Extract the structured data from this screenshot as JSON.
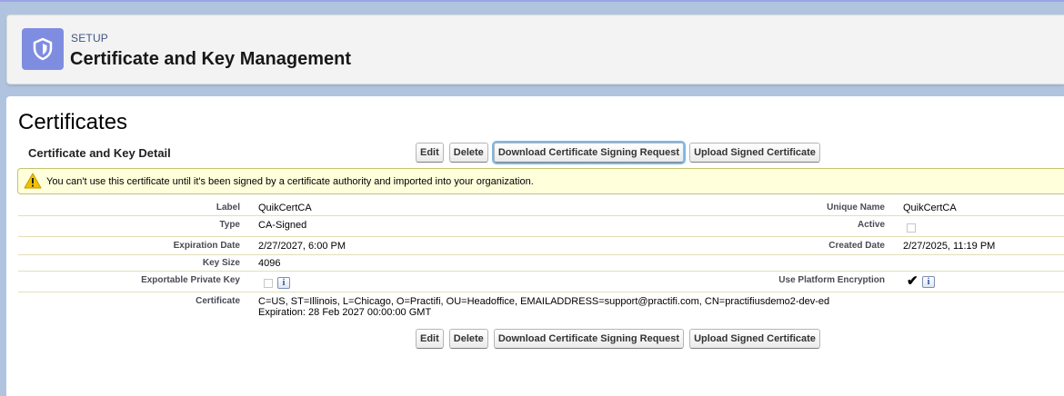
{
  "header": {
    "setup_label": "SETUP",
    "title": "Certificate and Key Management",
    "icon": "shield-lock-icon",
    "icon_bg": "#7f8de1"
  },
  "section": {
    "title": "Certificates",
    "block_title": "Certificate and Key Detail"
  },
  "buttons": {
    "edit": "Edit",
    "delete": "Delete",
    "download_csr": "Download Certificate Signing Request",
    "upload_signed": "Upload Signed Certificate"
  },
  "warning": {
    "icon": "warning-triangle-icon",
    "text": "You can't use this certificate until it's been signed by a certificate authority and imported into your organization."
  },
  "details": {
    "label": {
      "label": "Label",
      "value": "QuikCertCA"
    },
    "unique_name": {
      "label": "Unique Name",
      "value": "QuikCertCA"
    },
    "type": {
      "label": "Type",
      "value": "CA-Signed"
    },
    "active": {
      "label": "Active",
      "checked": false
    },
    "expiration_date": {
      "label": "Expiration Date",
      "value": "2/27/2027, 6:00 PM"
    },
    "created_date": {
      "label": "Created Date",
      "value": "2/27/2025, 11:19 PM"
    },
    "key_size": {
      "label": "Key Size",
      "value": "4096"
    },
    "exportable_private_key": {
      "label": "Exportable Private Key",
      "checked": false,
      "info_glyph": "i"
    },
    "use_platform_encryption": {
      "label": "Use Platform Encryption",
      "checked": true,
      "info_glyph": "i"
    },
    "certificate": {
      "label": "Certificate",
      "line1": "C=US, ST=Illinois, L=Chicago, O=Practifi, OU=Headoffice, EMAILADDRESS=support@practifi.com, CN=practifiusdemo2-dev-ed",
      "line2": "Expiration: 28 Feb 2027 00:00:00 GMT"
    }
  },
  "colors": {
    "warning_bg": "#ffffdc",
    "page_bg": "#b0c4df",
    "accent_outline": "#7cb6e8"
  }
}
